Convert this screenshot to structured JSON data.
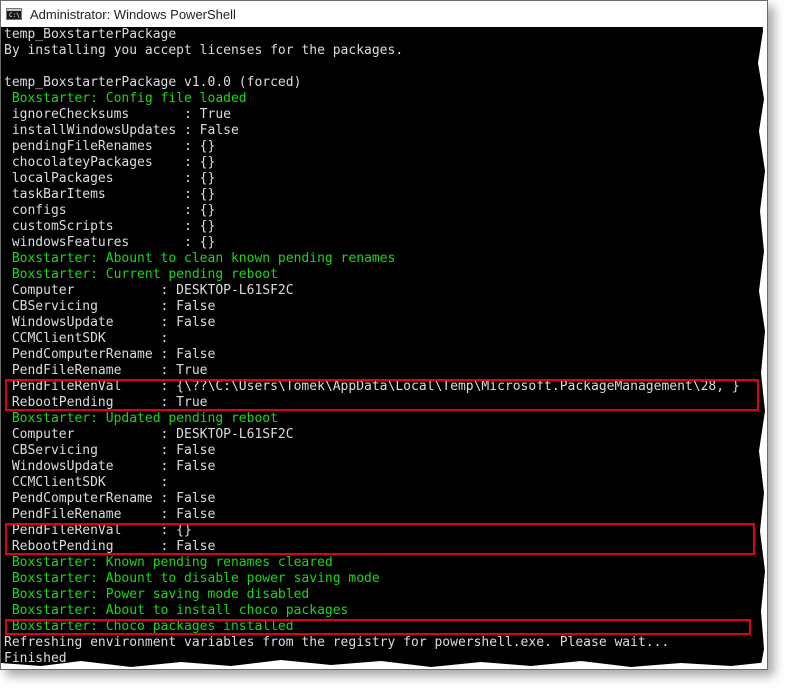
{
  "window": {
    "title": "Administrator: Windows PowerShell",
    "icon_label": "C:\\",
    "icon": "powershell-console-icon"
  },
  "colors": {
    "console_background": "#000000",
    "console_text": "#cccccc",
    "success_text": "#18d818",
    "highlight_border": "#e0001a"
  },
  "console": {
    "lines": [
      {
        "text": "temp_BoxstarterPackage",
        "style": "white"
      },
      {
        "text": "By installing you accept licenses for the packages.",
        "style": "white"
      },
      {
        "text": "",
        "style": "white"
      },
      {
        "text": "temp_BoxstarterPackage v1.0.0 (forced)",
        "style": "white"
      },
      {
        "text": " Boxstarter: Config file loaded",
        "style": "green"
      },
      {
        "text": " ignoreChecksums       : True",
        "style": "white"
      },
      {
        "text": " installWindowsUpdates : False",
        "style": "white"
      },
      {
        "text": " pendingFileRenames    : {}",
        "style": "white"
      },
      {
        "text": " chocolateyPackages    : {}",
        "style": "white"
      },
      {
        "text": " localPackages         : {}",
        "style": "white"
      },
      {
        "text": " taskBarItems          : {}",
        "style": "white"
      },
      {
        "text": " configs               : {}",
        "style": "white"
      },
      {
        "text": " customScripts         : {}",
        "style": "white"
      },
      {
        "text": " windowsFeatures       : {}",
        "style": "white"
      },
      {
        "text": " Boxstarter: Abount to clean known pending renames",
        "style": "green"
      },
      {
        "text": " Boxstarter: Current pending reboot",
        "style": "green"
      },
      {
        "text": " Computer           : DESKTOP-L61SF2C",
        "style": "white"
      },
      {
        "text": " CBServicing        : False",
        "style": "white"
      },
      {
        "text": " WindowsUpdate      : False",
        "style": "white"
      },
      {
        "text": " CCMClientSDK       :",
        "style": "white"
      },
      {
        "text": " PendComputerRename : False",
        "style": "white"
      },
      {
        "text": " PendFileRename     : True",
        "style": "white"
      },
      {
        "text": " PendFileRenVal     : {\\??\\C:\\Users\\Tomek\\AppData\\Local\\Temp\\Microsoft.PackageManagement\\28, }",
        "style": "white"
      },
      {
        "text": " RebootPending      : True",
        "style": "white"
      },
      {
        "text": " Boxstarter: Updated pending reboot",
        "style": "green"
      },
      {
        "text": " Computer           : DESKTOP-L61SF2C",
        "style": "white"
      },
      {
        "text": " CBServicing        : False",
        "style": "white"
      },
      {
        "text": " WindowsUpdate      : False",
        "style": "white"
      },
      {
        "text": " CCMClientSDK       :",
        "style": "white"
      },
      {
        "text": " PendComputerRename : False",
        "style": "white"
      },
      {
        "text": " PendFileRename     : False",
        "style": "white"
      },
      {
        "text": " PendFileRenVal     : {}",
        "style": "white"
      },
      {
        "text": " RebootPending      : False",
        "style": "white"
      },
      {
        "text": " Boxstarter: Known pending renames cleared",
        "style": "green"
      },
      {
        "text": " Boxstarter: Abount to disable power saving mode",
        "style": "green"
      },
      {
        "text": " Boxstarter: Power saving mode disabled",
        "style": "green"
      },
      {
        "text": " Boxstarter: About to install choco packages",
        "style": "green"
      },
      {
        "text": " Boxstarter: Choco packages installed",
        "style": "green"
      },
      {
        "text": "Refreshing environment variables from the registry for powershell.exe. Please wait...",
        "style": "white"
      },
      {
        "text": "Finished",
        "style": "white"
      }
    ]
  }
}
